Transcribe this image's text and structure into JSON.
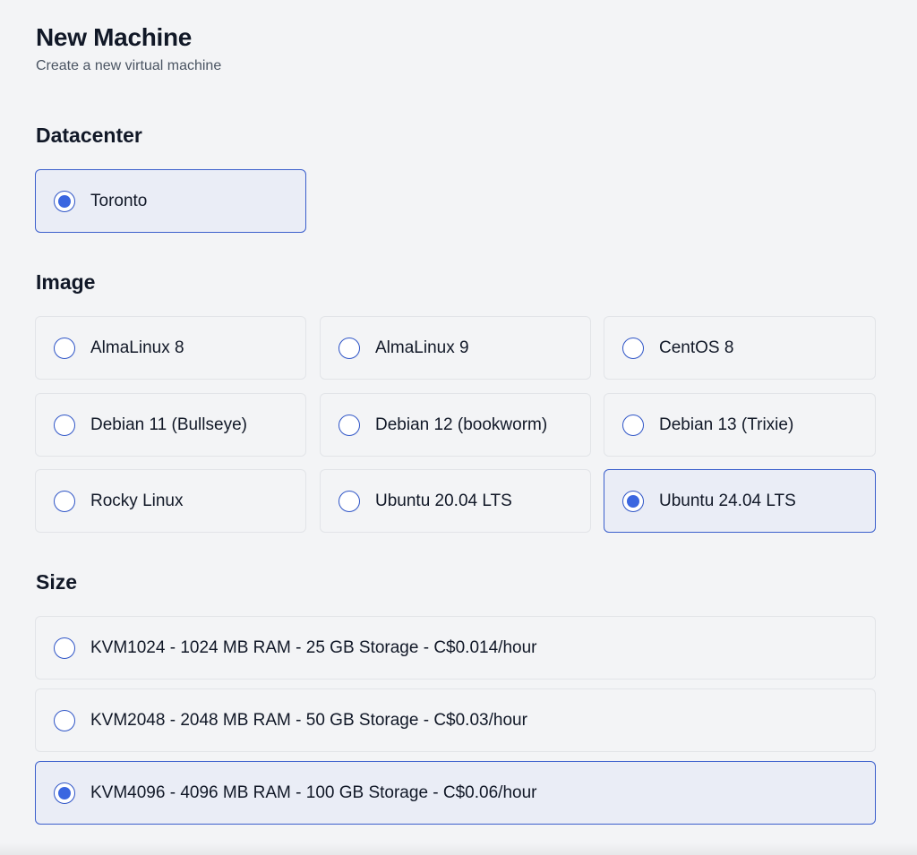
{
  "header": {
    "title": "New Machine",
    "subtitle": "Create a new virtual machine"
  },
  "datacenter": {
    "heading": "Datacenter",
    "options": [
      {
        "label": "Toronto",
        "selected": true
      }
    ]
  },
  "image": {
    "heading": "Image",
    "options": [
      {
        "label": "AlmaLinux 8",
        "selected": false
      },
      {
        "label": "AlmaLinux 9",
        "selected": false
      },
      {
        "label": "CentOS 8",
        "selected": false
      },
      {
        "label": "Debian 11 (Bullseye)",
        "selected": false
      },
      {
        "label": "Debian 12 (bookworm)",
        "selected": false
      },
      {
        "label": "Debian 13 (Trixie)",
        "selected": false
      },
      {
        "label": "Rocky Linux",
        "selected": false
      },
      {
        "label": "Ubuntu 20.04 LTS",
        "selected": false
      },
      {
        "label": "Ubuntu 24.04 LTS",
        "selected": true
      }
    ]
  },
  "size": {
    "heading": "Size",
    "options": [
      {
        "label": "KVM1024 - 1024 MB RAM - 25 GB Storage - C$0.014/hour",
        "selected": false
      },
      {
        "label": "KVM2048 - 2048 MB RAM - 50 GB Storage - C$0.03/hour",
        "selected": false
      },
      {
        "label": "KVM4096 - 4096 MB RAM - 100 GB Storage - C$0.06/hour",
        "selected": true
      }
    ]
  },
  "colors": {
    "page_background": "#f3f4f6",
    "selected_border": "#3b5fcc",
    "selected_background": "#eaedf6",
    "radio_accent": "#3a66e0"
  }
}
